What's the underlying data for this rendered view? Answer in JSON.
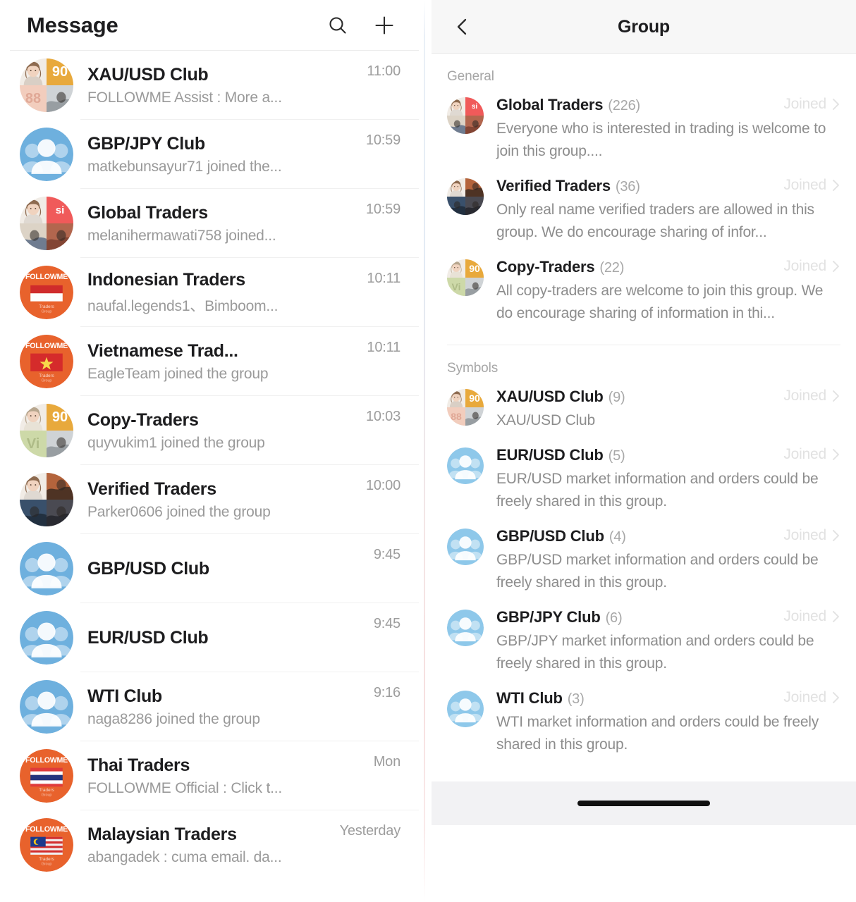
{
  "messages_panel": {
    "title": "Message",
    "search_icon": "search-icon",
    "add_icon": "plus-icon",
    "items": [
      {
        "name": "XAU/USD Club",
        "preview": "FOLLOWME Assist : More a...",
        "time": "11:00",
        "avatar": "quad-xau"
      },
      {
        "name": "GBP/JPY Club",
        "preview": "matkebunsayur71 joined the...",
        "time": "10:59",
        "avatar": "group-blue"
      },
      {
        "name": "Global Traders",
        "preview": "melanihermawati758 joined...",
        "time": "10:59",
        "avatar": "quad-global"
      },
      {
        "name": "Indonesian Traders",
        "preview": "naufal.legends1、Bimboom...",
        "time": "10:11",
        "avatar": "flag-indonesia"
      },
      {
        "name": "Vietnamese Trad...",
        "preview": "EagleTeam joined the group",
        "time": "10:11",
        "avatar": "flag-vietnam"
      },
      {
        "name": "Copy-Traders",
        "preview": "quyvukim1 joined the group",
        "time": "10:03",
        "avatar": "quad-copy"
      },
      {
        "name": "Verified Traders",
        "preview": "Parker0606 joined the group",
        "time": "10:00",
        "avatar": "quad-verified"
      },
      {
        "name": "GBP/USD Club",
        "preview": "",
        "time": "9:45",
        "avatar": "group-blue"
      },
      {
        "name": "EUR/USD Club",
        "preview": "",
        "time": "9:45",
        "avatar": "group-blue"
      },
      {
        "name": "WTI Club",
        "preview": "naga8286 joined the group",
        "time": "9:16",
        "avatar": "group-blue"
      },
      {
        "name": "Thai Traders",
        "preview": "FOLLOWME Official : Click t...",
        "time": "Mon",
        "avatar": "flag-thailand"
      },
      {
        "name": "Malaysian Traders",
        "preview": "abangadek : cuma email. da...",
        "time": "Yesterday",
        "avatar": "flag-malaysia"
      }
    ]
  },
  "group_panel": {
    "title": "Group",
    "back_icon": "chevron-left-icon",
    "sections": [
      {
        "label": "General",
        "items": [
          {
            "name": "Global Traders",
            "count": "(226)",
            "desc": "Everyone who is interested in trading is welcome to join this group....",
            "status": "Joined",
            "avatar": "quad-global"
          },
          {
            "name": "Verified Traders",
            "count": "(36)",
            "desc": "Only real name verified traders are allowed in this group. We do encourage sharing of infor...",
            "status": "Joined",
            "avatar": "quad-verified"
          },
          {
            "name": "Copy-Traders",
            "count": "(22)",
            "desc": "All copy-traders are welcome to join this group. We do encourage sharing of information in thi...",
            "status": "Joined",
            "avatar": "quad-copy"
          }
        ]
      },
      {
        "label": "Symbols",
        "items": [
          {
            "name": "XAU/USD Club",
            "count": "(9)",
            "desc": "XAU/USD Club",
            "status": "Joined",
            "avatar": "quad-xau"
          },
          {
            "name": "EUR/USD Club",
            "count": "(5)",
            "desc": "EUR/USD market information and orders could be freely shared in this group.",
            "status": "Joined",
            "avatar": "group-blue-light"
          },
          {
            "name": "GBP/USD Club",
            "count": "(4)",
            "desc": "GBP/USD market information and orders could be freely shared in this group.",
            "status": "Joined",
            "avatar": "group-blue-light"
          },
          {
            "name": "GBP/JPY Club",
            "count": "(6)",
            "desc": "GBP/JPY market information and orders could be freely shared in this group.",
            "status": "Joined",
            "avatar": "group-blue-light"
          },
          {
            "name": "WTI Club",
            "count": "(3)",
            "desc": "WTI market information and orders could be freely shared in this group.",
            "status": "Joined",
            "avatar": "group-blue-light"
          }
        ]
      }
    ],
    "chevron_icon": "chevron-right-icon",
    "home_indicator": "home-indicator"
  },
  "avatar_badges": {
    "xau_tr": "90",
    "xau_bl": "88",
    "global_tr": "si",
    "copy_tr": "90",
    "copy_bl": "Vi",
    "brand_text": "FOLLOWME"
  },
  "colors": {
    "accent_orange": "#e8622c",
    "group_blue": "#6eb0de",
    "badge_gold": "#e8a93c",
    "badge_red": "#f05a5a",
    "badge_green": "#cdd9a8",
    "badge_peach": "#f2cdbd",
    "text_primary": "#1d1d1f",
    "text_secondary": "#9a9a9a",
    "joined_grey": "#e2e2e2"
  }
}
